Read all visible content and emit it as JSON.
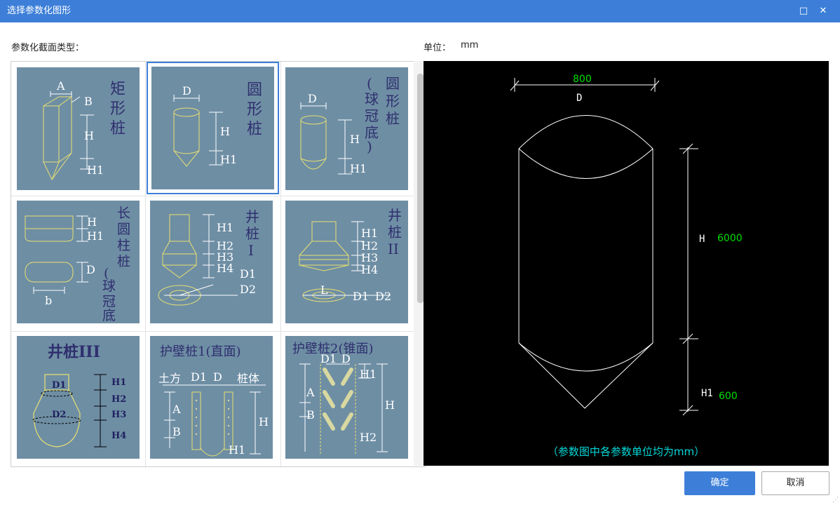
{
  "window": {
    "title": "选择参数化图形",
    "maximize_glyph": "□",
    "close_glyph": "✕"
  },
  "labels": {
    "section_type": "参数化截面类型：",
    "unit_label": "单位：",
    "unit_value": "mm"
  },
  "shapes": [
    {
      "name": "矩形桩",
      "params": [
        "A",
        "B",
        "H",
        "H1"
      ]
    },
    {
      "name": "圆形桩",
      "params": [
        "D",
        "H",
        "H1"
      ],
      "selected": true
    },
    {
      "name": "圆形桩（球冠底）",
      "params": [
        "D",
        "H",
        "H1"
      ]
    },
    {
      "name": "长圆柱桩（球冠底）",
      "params": [
        "H",
        "H1",
        "D",
        "b"
      ]
    },
    {
      "name": "井桩Ⅰ",
      "params": [
        "H1",
        "H2",
        "H3",
        "H4",
        "D1",
        "D2"
      ]
    },
    {
      "name": "井桩Ⅱ",
      "params": [
        "H1",
        "H2",
        "H3",
        "H4",
        "L",
        "D1",
        "D2"
      ]
    },
    {
      "name": "井桩Ⅲ",
      "params": [
        "D1",
        "D2",
        "H1",
        "H2",
        "H3",
        "H4"
      ]
    },
    {
      "name": "护壁桩1(直面)",
      "params": [
        "土方",
        "D1",
        "D",
        "桩体",
        "A",
        "B",
        "H",
        "H1"
      ]
    },
    {
      "name": "护壁桩2(锥面)",
      "params": [
        "D1",
        "D",
        "H1",
        "A",
        "B",
        "H",
        "H2"
      ]
    }
  ],
  "preview": {
    "D_value": "800",
    "D_label": "D",
    "H_label": "H",
    "H_value": "6000",
    "H1_label": "H1",
    "H1_value": "600",
    "note": "（参数图中各参数单位均为mm）",
    "value_color": "#00e000",
    "note_color": "#00d8d8"
  },
  "buttons": {
    "ok": "确定",
    "cancel": "取消"
  }
}
